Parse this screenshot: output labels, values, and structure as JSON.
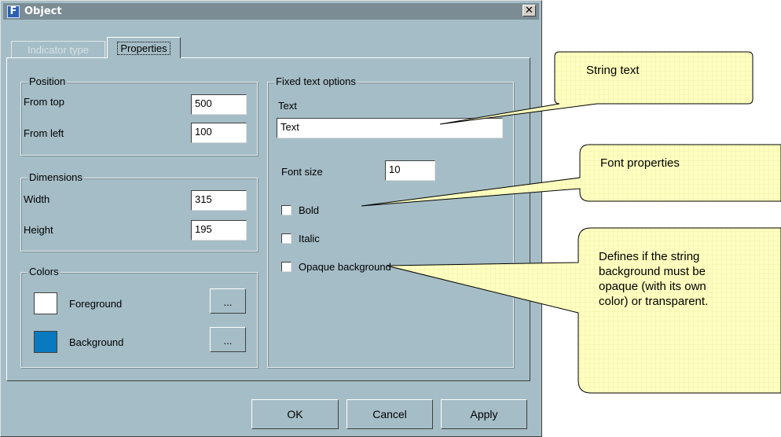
{
  "window": {
    "title": "Object",
    "icon": "F"
  },
  "tabs": [
    {
      "label": "Indicator type"
    },
    {
      "label": "Properties"
    }
  ],
  "position": {
    "legend": "Position",
    "from_top_label": "From top",
    "from_top_value": "500",
    "from_left_label": "From left",
    "from_left_value": "100"
  },
  "dimensions": {
    "legend": "Dimensions",
    "width_label": "Width",
    "width_value": "315",
    "height_label": "Height",
    "height_value": "195"
  },
  "colors": {
    "legend": "Colors",
    "foreground_label": "Foreground",
    "foreground_color": "#ffffff",
    "background_label": "Background",
    "background_color": "#0a7ac0",
    "picker_label": "..."
  },
  "fixed_text": {
    "legend": "Fixed text options",
    "text_label": "Text",
    "text_value": "Text",
    "font_size_label": "Font size",
    "font_size_value": "10",
    "bold_label": "Bold",
    "italic_label": "Italic",
    "opaque_label": "Opaque background"
  },
  "buttons": {
    "ok": "OK",
    "cancel": "Cancel",
    "apply": "Apply"
  },
  "callouts": {
    "string_text": "String text",
    "font_properties": "Font properties",
    "opaque_line1": "Defines if the string",
    "opaque_line2": "background must be",
    "opaque_line3": "opaque (with its own",
    "opaque_line4": "color) or transparent."
  },
  "accent_colors": {
    "dialog_bg": "#a5bdc6",
    "titlebar": "#7b8c94",
    "callout_fill": "#ffffc0"
  }
}
